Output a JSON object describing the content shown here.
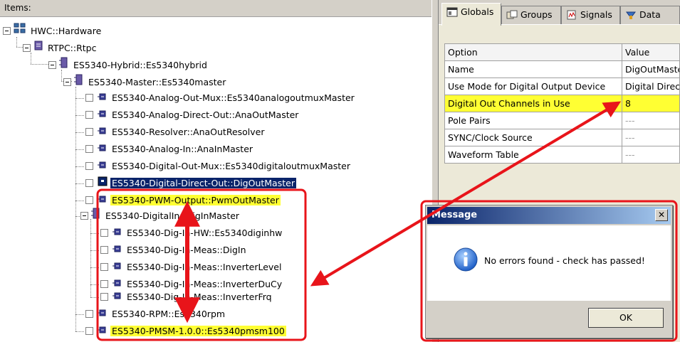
{
  "items_header": "Items:",
  "tree": {
    "root": "HWC::Hardware",
    "rtpc": "RTPC::Rtpc",
    "hybrid": "ES5340-Hybrid::Es5340hybrid",
    "master": "ES5340-Master::Es5340master",
    "children": [
      "ES5340-Analog-Out-Mux::Es5340analogoutmuxMaster",
      "ES5340-Analog-Direct-Out::AnaOutMaster",
      "ES5340-Resolver::AnaOutResolver",
      "ES5340-Analog-In::AnaInMaster",
      "ES5340-Digital-Out-Mux::Es5340digitaloutmuxMaster",
      "ES5340-Digital-Direct-Out::DigOutMaster",
      "ES5340-PWM-Output::PwmOutMaster",
      "ES5340-DigitalIn::DigInMaster"
    ],
    "digin_children": [
      "ES5340-Dig-In-HW::Es5340diginhw",
      "ES5340-Dig-In-Meas::DigIn",
      "ES5340-Dig-In-Meas::InverterLevel",
      "ES5340-Dig-In-Meas::InverterDuCy",
      "ES5340-Dig-In-Meas::InverterFrq"
    ],
    "rpm": "ES5340-RPM::Es5340rpm",
    "pmsm": "ES5340-PMSM-1.0.0::Es5340pmsm100"
  },
  "tabs": [
    "Globals",
    "Groups",
    "Signals",
    "Data"
  ],
  "table": {
    "headers": [
      "Option",
      "Value"
    ],
    "rows": [
      {
        "option": "Name",
        "value": "DigOutMaster"
      },
      {
        "option": "Use Mode for Digital Output Device",
        "value": "Digital Direct Out"
      },
      {
        "option": "Digital Out Channels in Use",
        "value": "8"
      },
      {
        "option": "Pole Pairs",
        "value": "---"
      },
      {
        "option": "SYNC/Clock Source",
        "value": "---"
      },
      {
        "option": "Waveform Table",
        "value": "---"
      }
    ]
  },
  "dialog": {
    "title": "Message",
    "close": "✕",
    "text": "No errors found - check has passed!",
    "ok": "OK"
  },
  "colors": {
    "highlight_yellow": "#ffff33",
    "selection_blue": "#0a246a",
    "annotation_red": "#e8141a"
  }
}
